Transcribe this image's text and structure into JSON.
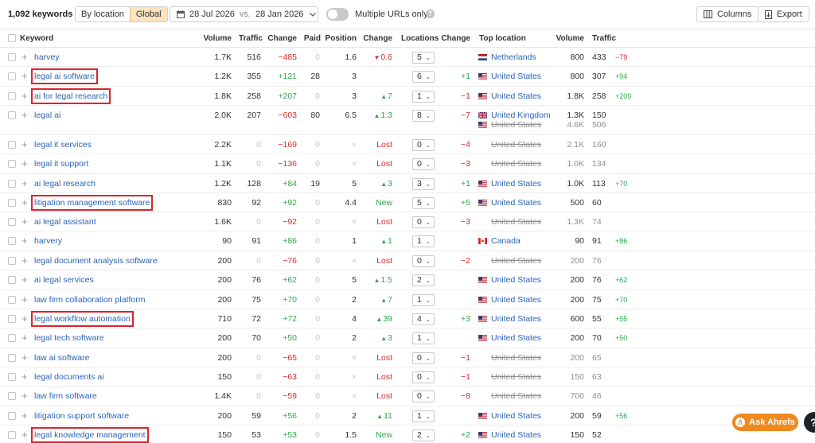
{
  "toolbar": {
    "keyword_count": "1,092 keywords",
    "by_location": "By location",
    "global": "Global",
    "date_from": "28 Jul 2026",
    "vs": "vs.",
    "date_to": "28 Jan 2026",
    "multiple_urls": "Multiple URLs only",
    "help": "?",
    "columns": "Columns",
    "export": "Export"
  },
  "headers": {
    "keyword": "Keyword",
    "volume": "Volume",
    "traffic": "Traffic",
    "change": "Change",
    "paid": "Paid",
    "position": "Position",
    "pos_change": "Change",
    "locations": "Locations",
    "loc_change": "Change",
    "top_location": "Top location",
    "loc_volume": "Volume",
    "loc_traffic": "Traffic"
  },
  "rows": [
    {
      "keyword": "harvey",
      "volume": "1.7K",
      "traffic": "516",
      "change": "−485",
      "paid": "0",
      "position": "1.6",
      "pos_change": "0.6",
      "pos_dir": "down",
      "locations": "5",
      "loc_change": "",
      "country": "Netherlands",
      "flag": "nl",
      "loc_volume": "800",
      "loc_traffic": "433",
      "loc_traffic_change": "−79",
      "boxed": false
    },
    {
      "keyword": "legal ai software",
      "volume": "1.2K",
      "traffic": "355",
      "change": "+121",
      "paid": "28",
      "position": "3",
      "pos_change": "",
      "pos_dir": "",
      "locations": "6",
      "loc_change": "+1",
      "country": "United States",
      "flag": "us",
      "loc_volume": "800",
      "loc_traffic": "307",
      "loc_traffic_change": "+94",
      "boxed": true
    },
    {
      "keyword": "ai for legal research",
      "volume": "1.8K",
      "traffic": "258",
      "change": "+207",
      "paid": "0",
      "position": "3",
      "pos_change": "7",
      "pos_dir": "up",
      "locations": "1",
      "loc_change": "−1",
      "country": "United States",
      "flag": "us",
      "loc_volume": "1.8K",
      "loc_traffic": "258",
      "loc_traffic_change": "+209",
      "boxed": true
    },
    {
      "keyword": "legal ai",
      "volume": "2.0K",
      "traffic": "207",
      "change": "−603",
      "paid": "80",
      "position": "6.5",
      "pos_change": "1.3",
      "pos_dir": "up",
      "locations": "8",
      "loc_change": "−7",
      "country": "United Kingdom",
      "flag": "uk",
      "loc_volume": "1.3K",
      "loc_traffic": "150",
      "loc_traffic_change": "",
      "boxed": false,
      "second": {
        "country": "United States",
        "loc_volume": "4.6K",
        "loc_traffic": "506"
      }
    },
    {
      "keyword": "legal it services",
      "volume": "2.2K",
      "traffic": "0",
      "change": "−169",
      "paid": "0",
      "position": "×",
      "pos_change": "Lost",
      "pos_dir": "lost",
      "locations": "0",
      "loc_change": "−4",
      "country": "United States",
      "flag": "",
      "loc_volume": "2.1K",
      "loc_traffic": "160",
      "loc_traffic_change": "",
      "boxed": false
    },
    {
      "keyword": "legal it support",
      "volume": "1.1K",
      "traffic": "0",
      "change": "−136",
      "paid": "0",
      "position": "×",
      "pos_change": "Lost",
      "pos_dir": "lost",
      "locations": "0",
      "loc_change": "−3",
      "country": "United States",
      "flag": "",
      "loc_volume": "1.0K",
      "loc_traffic": "134",
      "loc_traffic_change": "",
      "boxed": false
    },
    {
      "keyword": "ai legal research",
      "volume": "1.2K",
      "traffic": "128",
      "change": "+84",
      "paid": "19",
      "position": "5",
      "pos_change": "3",
      "pos_dir": "up",
      "locations": "3",
      "loc_change": "+1",
      "country": "United States",
      "flag": "us",
      "loc_volume": "1.0K",
      "loc_traffic": "113",
      "loc_traffic_change": "+70",
      "boxed": false
    },
    {
      "keyword": "litigation management software",
      "volume": "830",
      "traffic": "92",
      "change": "+92",
      "paid": "0",
      "position": "4.4",
      "pos_change": "New",
      "pos_dir": "new",
      "locations": "5",
      "loc_change": "+5",
      "country": "United States",
      "flag": "us",
      "loc_volume": "500",
      "loc_traffic": "60",
      "loc_traffic_change": "",
      "boxed": true
    },
    {
      "keyword": "ai legal assistant",
      "volume": "1.6K",
      "traffic": "0",
      "change": "−92",
      "paid": "0",
      "position": "×",
      "pos_change": "Lost",
      "pos_dir": "lost",
      "locations": "0",
      "loc_change": "−3",
      "country": "United States",
      "flag": "",
      "loc_volume": "1.3K",
      "loc_traffic": "74",
      "loc_traffic_change": "",
      "boxed": false
    },
    {
      "keyword": "harvery",
      "volume": "90",
      "traffic": "91",
      "change": "+86",
      "paid": "0",
      "position": "1",
      "pos_change": "1",
      "pos_dir": "up",
      "locations": "1",
      "loc_change": "",
      "country": "Canada",
      "flag": "ca",
      "loc_volume": "90",
      "loc_traffic": "91",
      "loc_traffic_change": "+86",
      "boxed": false
    },
    {
      "keyword": "legal document analysis software",
      "volume": "200",
      "traffic": "0",
      "change": "−76",
      "paid": "0",
      "position": "×",
      "pos_change": "Lost",
      "pos_dir": "lost",
      "locations": "0",
      "loc_change": "−2",
      "country": "United States",
      "flag": "",
      "loc_volume": "200",
      "loc_traffic": "76",
      "loc_traffic_change": "",
      "boxed": false
    },
    {
      "keyword": "ai legal services",
      "volume": "200",
      "traffic": "76",
      "change": "+62",
      "paid": "0",
      "position": "5",
      "pos_change": "1.5",
      "pos_dir": "up",
      "locations": "2",
      "loc_change": "",
      "country": "United States",
      "flag": "us",
      "loc_volume": "200",
      "loc_traffic": "76",
      "loc_traffic_change": "+62",
      "boxed": false
    },
    {
      "keyword": "law firm collaboration platform",
      "volume": "200",
      "traffic": "75",
      "change": "+70",
      "paid": "0",
      "position": "2",
      "pos_change": "7",
      "pos_dir": "up",
      "locations": "1",
      "loc_change": "",
      "country": "United States",
      "flag": "us",
      "loc_volume": "200",
      "loc_traffic": "75",
      "loc_traffic_change": "+70",
      "boxed": false
    },
    {
      "keyword": "legal workflow automation",
      "volume": "710",
      "traffic": "72",
      "change": "+72",
      "paid": "0",
      "position": "4",
      "pos_change": "39",
      "pos_dir": "up",
      "locations": "4",
      "loc_change": "+3",
      "country": "United States",
      "flag": "us",
      "loc_volume": "600",
      "loc_traffic": "55",
      "loc_traffic_change": "+55",
      "boxed": true
    },
    {
      "keyword": "legal tech software",
      "volume": "200",
      "traffic": "70",
      "change": "+50",
      "paid": "0",
      "position": "2",
      "pos_change": "3",
      "pos_dir": "up",
      "locations": "1",
      "loc_change": "",
      "country": "United States",
      "flag": "us",
      "loc_volume": "200",
      "loc_traffic": "70",
      "loc_traffic_change": "+50",
      "boxed": false
    },
    {
      "keyword": "law ai software",
      "volume": "200",
      "traffic": "0",
      "change": "−65",
      "paid": "0",
      "position": "×",
      "pos_change": "Lost",
      "pos_dir": "lost",
      "locations": "0",
      "loc_change": "−1",
      "country": "United States",
      "flag": "",
      "loc_volume": "200",
      "loc_traffic": "65",
      "loc_traffic_change": "",
      "boxed": false
    },
    {
      "keyword": "legal documents ai",
      "volume": "150",
      "traffic": "0",
      "change": "−63",
      "paid": "0",
      "position": "×",
      "pos_change": "Lost",
      "pos_dir": "lost",
      "locations": "0",
      "loc_change": "−1",
      "country": "United States",
      "flag": "",
      "loc_volume": "150",
      "loc_traffic": "63",
      "loc_traffic_change": "",
      "boxed": false
    },
    {
      "keyword": "law firm software",
      "volume": "1.4K",
      "traffic": "0",
      "change": "−59",
      "paid": "0",
      "position": "×",
      "pos_change": "Lost",
      "pos_dir": "lost",
      "locations": "0",
      "loc_change": "−8",
      "country": "United States",
      "flag": "",
      "loc_volume": "700",
      "loc_traffic": "46",
      "loc_traffic_change": "",
      "boxed": false
    },
    {
      "keyword": "litigation support software",
      "volume": "200",
      "traffic": "59",
      "change": "+56",
      "paid": "0",
      "position": "2",
      "pos_change": "11",
      "pos_dir": "up",
      "locations": "1",
      "loc_change": "",
      "country": "United States",
      "flag": "us",
      "loc_volume": "200",
      "loc_traffic": "59",
      "loc_traffic_change": "+56",
      "boxed": false
    },
    {
      "keyword": "legal knowledge management",
      "volume": "150",
      "traffic": "53",
      "change": "+53",
      "paid": "0",
      "position": "1.5",
      "pos_change": "New",
      "pos_dir": "new",
      "locations": "2",
      "loc_change": "+2",
      "country": "United States",
      "flag": "us",
      "loc_volume": "150",
      "loc_traffic": "52",
      "loc_traffic_change": "",
      "boxed": true
    }
  ],
  "ask_button": "Ask Ahrefs",
  "ask_badge": "Λ",
  "help_bubble": "?",
  "colors": {
    "accent": "#f08a1e",
    "link": "#2a63b8",
    "positive": "#2ea84a",
    "negative": "#d92b2b",
    "highlight_box": "#d8252e"
  },
  "icons": [
    "calendar-icon",
    "chevron-down-icon",
    "columns-icon",
    "export-icon",
    "plus-icon",
    "help-icon"
  ]
}
